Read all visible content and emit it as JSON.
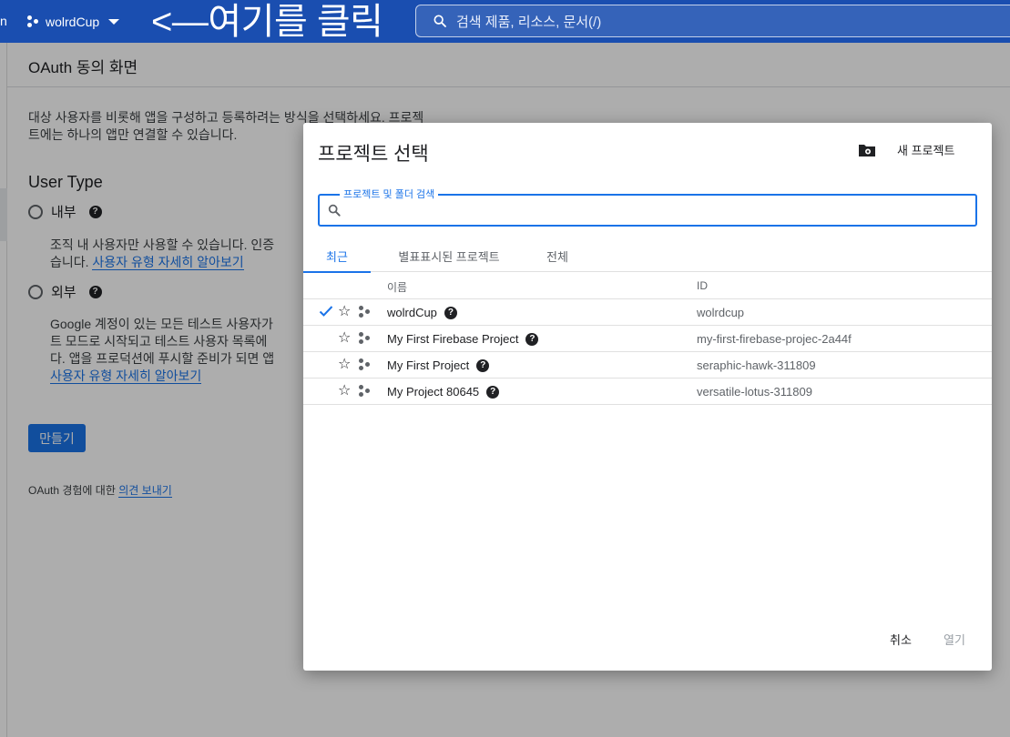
{
  "topbar": {
    "edge_text": "n",
    "project_name": "wolrdCup",
    "annotation": "<—여기를 클릭",
    "search_placeholder": "검색   제품, 리소스, 문서(/)"
  },
  "page": {
    "title": "OAuth 동의 화면",
    "intro_line1": "대상 사용자를 비롯해 앱을 구성하고 등록하려는 방식을 선택하세요. 프로젝",
    "intro_line2": "트에는 하나의 앱만 연결할 수 있습니다.",
    "user_type_heading": "User Type",
    "internal": {
      "label": "내부",
      "desc_line1": "조직 내 사용자만 사용할 수 있습니다. 인증",
      "desc_line2_prefix": "습니다. ",
      "desc_link": "사용자 유형 자세히 알아보기"
    },
    "external": {
      "label": "외부",
      "desc_line1": "Google 계정이 있는 모든 테스트 사용자가",
      "desc_line2": "트 모드로 시작되고 테스트 사용자 목록에",
      "desc_line3": "다. 앱을 프로덕션에 푸시할 준비가 되면 앱",
      "desc_link": "사용자 유형 자세히 알아보기"
    },
    "create_label": "만들기",
    "feedback_prefix": "OAuth 경험에 대한 ",
    "feedback_link": "의견 보내기"
  },
  "dialog": {
    "title": "프로젝트 선택",
    "new_project_label": "새 프로젝트",
    "search_label": "프로젝트 및 폴더 검색",
    "tabs": [
      {
        "label": "최근"
      },
      {
        "label": "별표표시된 프로젝트"
      },
      {
        "label": "전체"
      }
    ],
    "col_name": "이름",
    "col_id": "ID",
    "rows": [
      {
        "name": "wolrdCup",
        "id": "wolrdcup"
      },
      {
        "name": "My First Firebase Project",
        "id": "my-first-firebase-projec-2a44f"
      },
      {
        "name": "My First Project",
        "id": "seraphic-hawk-311809"
      },
      {
        "name": "My Project 80645",
        "id": "versatile-lotus-311809"
      }
    ],
    "cancel_label": "취소",
    "open_label": "열기"
  },
  "colors": {
    "topbar": "#1a4eb0",
    "accent": "#1a73e8",
    "overlay": "rgba(0,0,0,0.32)"
  },
  "icons": [
    "search-icon",
    "project-dots-icon",
    "dropdown-caret-icon",
    "help-icon",
    "new-folder-icon",
    "check-icon",
    "star-icon"
  ]
}
